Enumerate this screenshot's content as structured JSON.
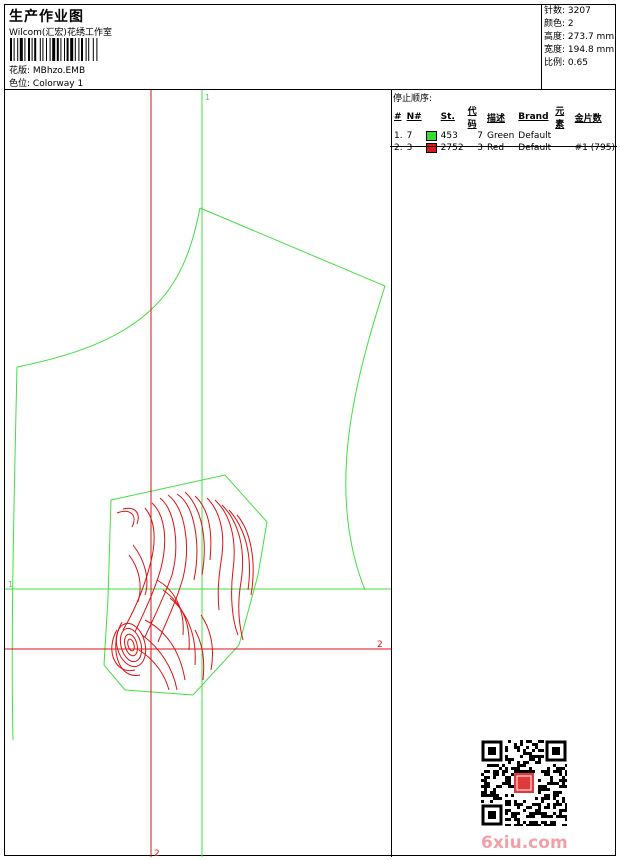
{
  "header": {
    "title": "生产作业图",
    "company": "Wilcom(汇宏)花绣工作室",
    "design_label": "花版:",
    "design_value": "MBhzo.EMB",
    "colorway_label": "色位:",
    "colorway_value": "Colorway 1"
  },
  "stats": [
    {
      "label": "针数:",
      "value": "3207"
    },
    {
      "label": "颜色:",
      "value": "2"
    },
    {
      "label": "高度:",
      "value": "273.7 mm"
    },
    {
      "label": "宽度:",
      "value": "194.8 mm"
    },
    {
      "label": "比例:",
      "value": "0.65"
    }
  ],
  "stop_sequence": {
    "title": "停止顺序:",
    "columns": [
      "#",
      "N#",
      "St.",
      "代码",
      "描述",
      "Brand",
      "元素",
      "金片数"
    ],
    "rows": [
      {
        "num": "1.",
        "n": "7",
        "color": "#33dd33",
        "st": "453",
        "code": "7",
        "desc": "Green",
        "brand": "Default",
        "element": "",
        "sequins": ""
      },
      {
        "num": "2.",
        "n": "3",
        "color": "#e01515",
        "st": "2752",
        "code": "3",
        "desc": "Red",
        "brand": "Default",
        "element": "",
        "sequins": "#1 (795)"
      }
    ]
  },
  "guides": {
    "green_v_label": "1",
    "green_h_label": "1",
    "red_h_label": "2",
    "red_v_label": "2",
    "green_color": "#44dd44",
    "red_color": "#dd1111"
  },
  "watermark": {
    "text": "6xiu.com"
  }
}
